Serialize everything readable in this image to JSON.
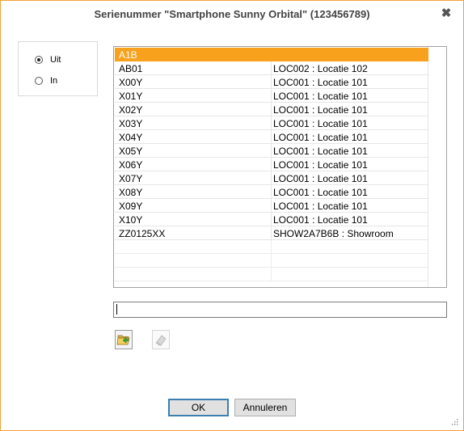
{
  "dialog": {
    "title": "Serienummer \"Smartphone Sunny Orbital\" (123456789)",
    "close_glyph": "✖",
    "accent_color": "#f7a11d"
  },
  "direction": {
    "options": [
      {
        "label": "Uit",
        "checked": true
      },
      {
        "label": "In",
        "checked": false
      }
    ]
  },
  "serial_list": {
    "rows": [
      {
        "serial": "A1B",
        "location": "",
        "selected": true
      },
      {
        "serial": "AB01",
        "location": "LOC002 : Locatie 102"
      },
      {
        "serial": "X00Y",
        "location": "LOC001 : Locatie 101"
      },
      {
        "serial": "X01Y",
        "location": "LOC001 : Locatie 101"
      },
      {
        "serial": "X02Y",
        "location": "LOC001 : Locatie 101"
      },
      {
        "serial": "X03Y",
        "location": "LOC001 : Locatie 101"
      },
      {
        "serial": "X04Y",
        "location": "LOC001 : Locatie 101"
      },
      {
        "serial": "X05Y",
        "location": "LOC001 : Locatie 101"
      },
      {
        "serial": "X06Y",
        "location": "LOC001 : Locatie 101"
      },
      {
        "serial": "X07Y",
        "location": "LOC001 : Locatie 101"
      },
      {
        "serial": "X08Y",
        "location": "LOC001 : Locatie 101"
      },
      {
        "serial": "X09Y",
        "location": "LOC001 : Locatie 101"
      },
      {
        "serial": "X10Y",
        "location": "LOC001 : Locatie 101"
      },
      {
        "serial": "ZZ0125XX",
        "location": "SHOW2A7B6B : Showroom"
      }
    ]
  },
  "serial_input": {
    "value": ""
  },
  "toolbar": {
    "open_icon": "folder-open-icon",
    "erase_icon": "eraser-icon"
  },
  "buttons": {
    "ok_label": "OK",
    "cancel_label": "Annuleren"
  }
}
